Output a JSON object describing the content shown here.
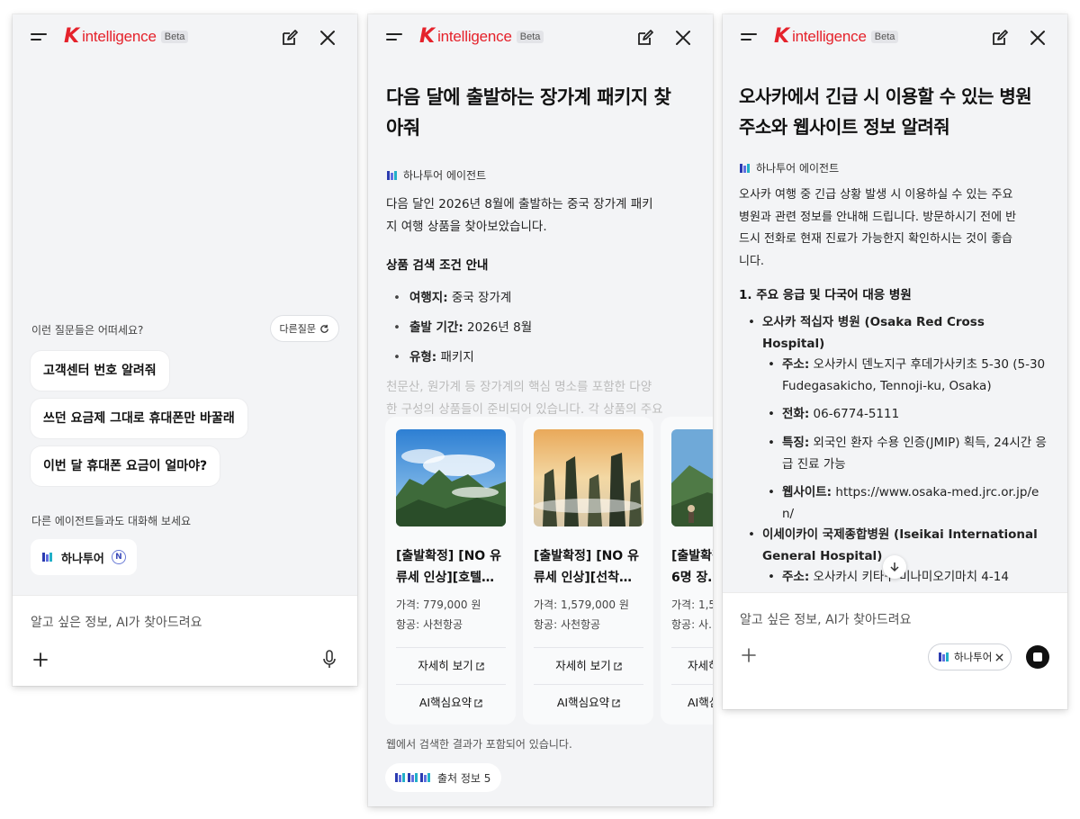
{
  "brand": {
    "logo_mark": "K",
    "logo_text": "intelligence",
    "badge": "Beta"
  },
  "panel1": {
    "suggest_title": "이런 질문들은 어떠세요?",
    "refresh_label": "다른질문",
    "suggestions": [
      "고객센터 번호 알려줘",
      "쓰던 요금제 그대로 휴대폰만 바꿀래",
      "이번 달 휴대폰 요금이 얼마야?"
    ],
    "agents_title": "다른 에이전트들과도 대화해 보세요",
    "agent_name": "하나투어",
    "agent_badge": "N",
    "input_placeholder": "알고 싶은 정보, AI가 찾아드려요"
  },
  "panel2": {
    "question_line1": "다음 달에 출발하는 장가계 패키지 찾",
    "question_line2": "아줘",
    "agent_label": "하나투어 에이전트",
    "intro_line1": "다음 달인 2026년 8월에 출발하는 중국 장가계 패키",
    "intro_line2": "지 여행 상품을 찾아보았습니다.",
    "section_title": "상품 검색 조건 안내",
    "conditions": [
      {
        "key": "여행지:",
        "value": " 중국 장가계"
      },
      {
        "key": "출발 기간:",
        "value": " 2026년 8월"
      },
      {
        "key": "유형:",
        "value": " 패키지"
      }
    ],
    "faded_line1": "천문산, 원가계 등 장가계의 핵심 명소를 포함한 다양",
    "faded_line2": "한 구성의 상품들이 준비되어 있습니다. 각 상품의 주요",
    "cards": [
      {
        "title_line1": "[출발확정] [NO 유",
        "title_line2": "류세 인상][호텔…",
        "price": "가격: 779,000 원",
        "airline": "항공: 사천항공",
        "detail": "자세히 보기",
        "summary": "AI핵심요약"
      },
      {
        "title_line1": "[출발확정] [NO 유",
        "title_line2": "류세 인상][선착…",
        "price": "가격: 1,579,000 원",
        "airline": "항공: 사천항공",
        "detail": "자세히 보기",
        "summary": "AI핵심요약"
      },
      {
        "title_line1": "[출발확정]",
        "title_line2": "6명 장…",
        "price": "가격: 1,5…",
        "airline": "항공: 사…",
        "detail": "자세히 보기",
        "summary": "AI핵심요약"
      }
    ],
    "web_note": "웹에서 검색한 결과가 포함되어 있습니다.",
    "source_label": "출처 정보 5"
  },
  "panel3": {
    "question_line1": "오사카에서 긴급 시 이용할 수 있는 병원",
    "question_line2": "주소와 웹사이트 정보 알려줘",
    "agent_label": "하나투어 에이전트",
    "intro_lines": [
      "오사카 여행 중 긴급 상황 발생 시 이용하실 수 있는 주요",
      "병원과 관련 정보를 안내해 드립니다. 방문하시기 전에 반",
      "드시 전화로 현재 진료가 가능한지 확인하시는 것이 좋습",
      "니다."
    ],
    "section_title": "1. 주요 응급 및 다국어 대응 병원",
    "hospital1_name": "오사카 적십자 병원 (Osaka Red Cross Hospital)",
    "hospital1_address_key": "주소:",
    "hospital1_address": " 오사카시 덴노지구 후데가사키초 5-30 (5-30 Fudegasakicho, Tennoji-ku, Osaka)",
    "hospital1_phone_key": "전화:",
    "hospital1_phone": " 06-6774-5111",
    "hospital1_feature_key": "특징:",
    "hospital1_feature": " 외국인 환자 수용 인증(JMIP) 획득, 24시간 응급 진료 가능",
    "hospital1_web_key": "웹사이트:",
    "hospital1_web": " https://www.osaka-med.jrc.or.jp/en/",
    "hospital2_name": "이세이카이 국제종합병원 (Iseikai International General Hospital)",
    "hospital2_address_key": "주소:",
    "hospital2_address": " 오사카시 키타구 미나미오기마치 4-14",
    "input_placeholder": "알고 싶은 정보, AI가 찾아드려요",
    "agent_chip": "하나투어"
  }
}
